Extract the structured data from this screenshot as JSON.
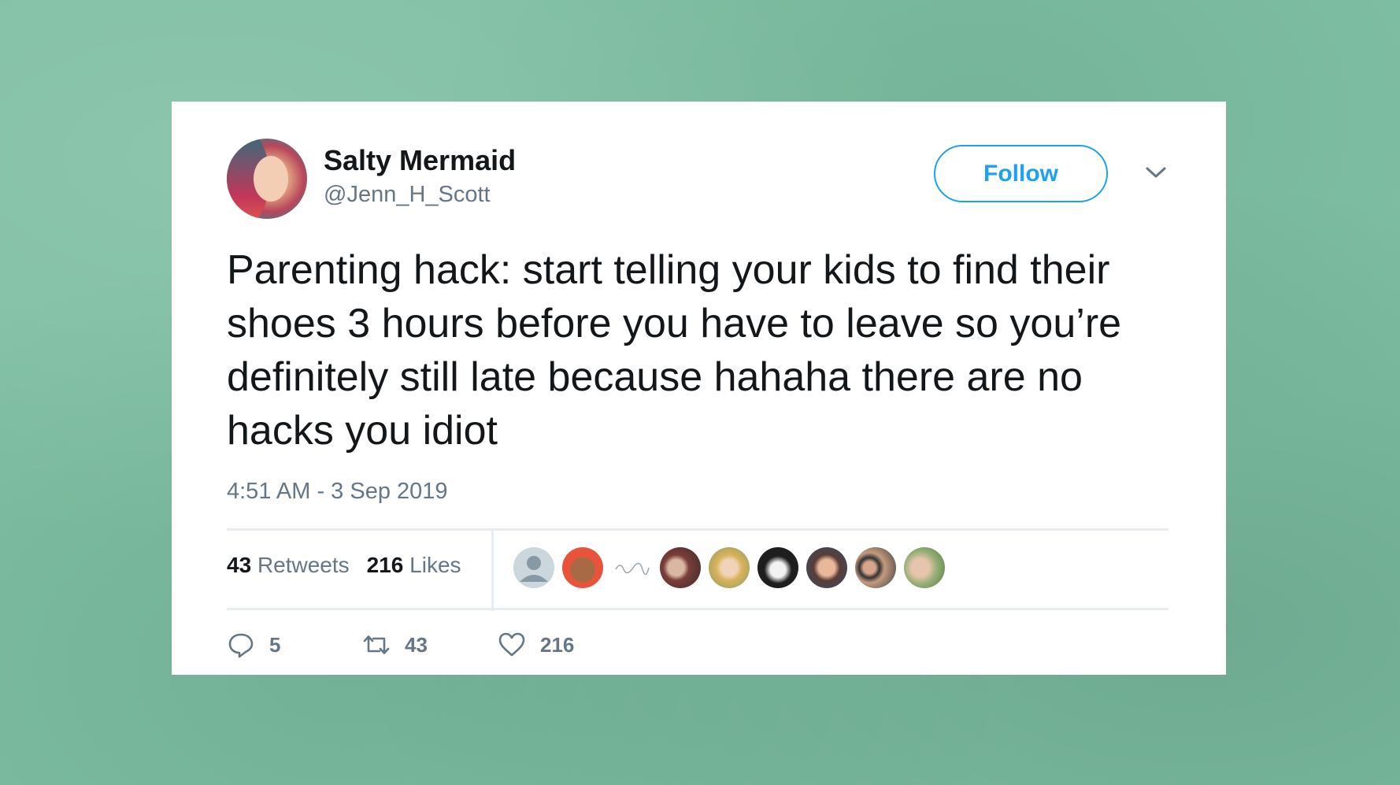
{
  "tweet": {
    "author": {
      "display_name": "Salty Mermaid",
      "handle": "@Jenn_H_Scott"
    },
    "follow_label": "Follow",
    "text": "Parenting hack: start telling your kids to find their shoes 3 hours before you have to leave so you’re definitely still late because hahaha there are no hacks you idiot",
    "timestamp": "4:51 AM - 3 Sep 2019",
    "stats": {
      "retweets_count": "43",
      "retweets_label": "Retweets",
      "likes_count": "216",
      "likes_label": "Likes"
    },
    "liker_avatars": [
      "default-avatar",
      "woman-sunglasses-avatar",
      "signature-logo-avatar",
      "couple-avatar",
      "blonde-woman-avatar",
      "painted-face-avatar",
      "woman-avatar",
      "two-men-avatar",
      "man-avatar"
    ],
    "actions": {
      "reply_count": "5",
      "retweet_count": "43",
      "like_count": "216"
    }
  },
  "colors": {
    "background": "#7fbfa3",
    "card": "#ffffff",
    "accent": "#1da1f2",
    "text_primary": "#14171a",
    "text_secondary": "#657786",
    "divider": "#e6ecf0"
  }
}
